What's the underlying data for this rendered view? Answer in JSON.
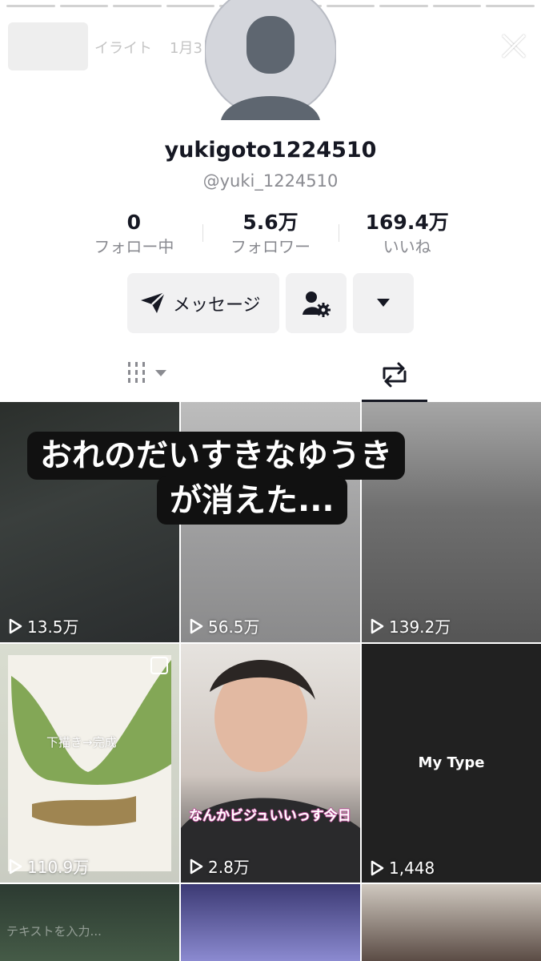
{
  "story": {
    "label": "イライト",
    "date": "1月3日",
    "close_icon": "close-icon"
  },
  "profile": {
    "username": "yukigoto1224510",
    "handle": "@yuki_1224510",
    "stats": [
      {
        "value": "0",
        "label": "フォロー中"
      },
      {
        "value": "5.6万",
        "label": "フォロワー"
      },
      {
        "value": "169.4万",
        "label": "いいね"
      }
    ],
    "message_button": "メッセージ"
  },
  "tabs": {
    "videos_icon": "grid-icon",
    "reposts_icon": "repost-icon",
    "active": "reposts"
  },
  "overlay_text": {
    "line1": "おれのだいすきなゆうき",
    "line2": "が消えた..."
  },
  "videos": [
    {
      "views": "13.5万"
    },
    {
      "views": "56.5万"
    },
    {
      "views": "139.2万"
    },
    {
      "views": "110.9万",
      "caption": "下描き→完成"
    },
    {
      "views": "2.8万",
      "caption": "なんかビジュいいっす今日"
    },
    {
      "views": "1,448",
      "caption": "My Type"
    },
    {
      "hint": "テキストを入力..."
    },
    {},
    {}
  ],
  "colors": {
    "text_primary": "#161823",
    "text_secondary": "#8a8b91",
    "button_bg": "#f1f1f2",
    "overlay_bg": "#111111"
  }
}
